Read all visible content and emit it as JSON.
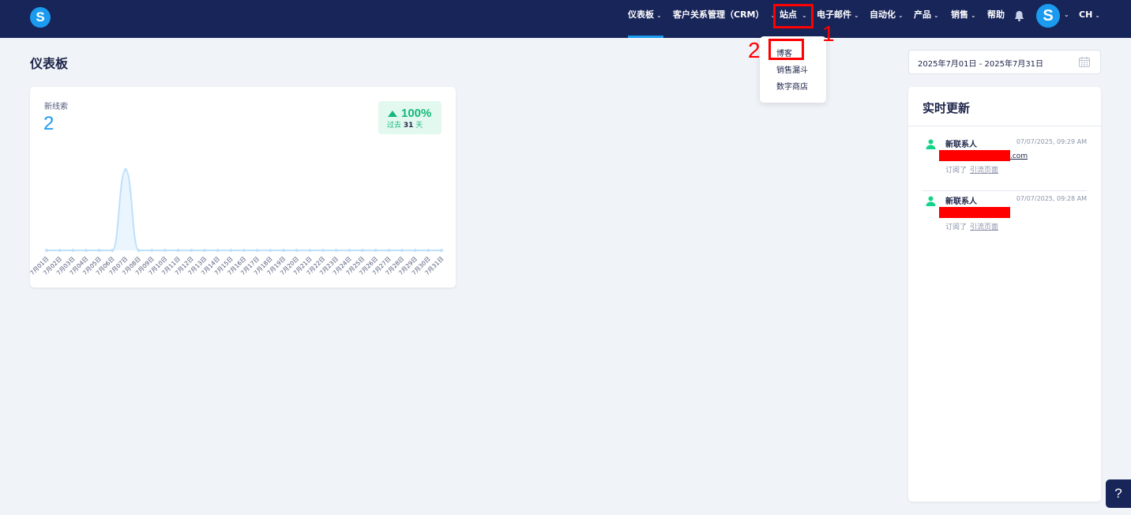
{
  "app": {
    "logo_letter": "S"
  },
  "nav": {
    "items": [
      {
        "label": "仪表板",
        "chevron": true
      },
      {
        "label": "客户关系管理（CRM）",
        "chevron": true
      },
      {
        "label": "站点",
        "chevron": true
      },
      {
        "label": "电子邮件",
        "chevron": true
      },
      {
        "label": "自动化",
        "chevron": true
      },
      {
        "label": "产品",
        "chevron": true
      },
      {
        "label": "销售",
        "chevron": true
      },
      {
        "label": "帮助",
        "chevron": false
      }
    ],
    "active": "仪表板",
    "avatar_letter": "S",
    "language": "CH",
    "bell_icon": "bell-icon"
  },
  "dropdown": {
    "items": [
      "博客",
      "销售漏斗",
      "数字商店"
    ]
  },
  "annotations": {
    "one": "1",
    "two": "2",
    "color": "#ff0000"
  },
  "page": {
    "title": "仪表板"
  },
  "date_range": {
    "value": "2025年7月01日 - 2025年7月31日",
    "icon": "calendar-icon"
  },
  "card": {
    "label": "新线索",
    "value": "2",
    "badge": {
      "percent": "100%",
      "prefix": "过去",
      "days": "31",
      "suffix": "天"
    }
  },
  "chart_data": {
    "type": "area",
    "categories": [
      "7月01日",
      "7月02日",
      "7月03日",
      "7月04日",
      "7月05日",
      "7月06日",
      "7月07日",
      "7月08日",
      "7月09日",
      "7月10日",
      "7月11日",
      "7月12日",
      "7月13日",
      "7月14日",
      "7月15日",
      "7月16日",
      "7月17日",
      "7月18日",
      "7月19日",
      "7月20日",
      "7月21日",
      "7月22日",
      "7月23日",
      "7月24日",
      "7月25日",
      "7月26日",
      "7月27日",
      "7月28日",
      "7月29日",
      "7月30日",
      "7月31日"
    ],
    "values": [
      0,
      0,
      0,
      0,
      0,
      0,
      2,
      0,
      0,
      0,
      0,
      0,
      0,
      0,
      0,
      0,
      0,
      0,
      0,
      0,
      0,
      0,
      0,
      0,
      0,
      0,
      0,
      0,
      0,
      0,
      0
    ],
    "ylim": [
      0,
      2
    ],
    "grid": false,
    "color": "#1a9bf0"
  },
  "realtime": {
    "title": "实时更新",
    "entries": [
      {
        "name": "新联系人",
        "time": "07/07/2025, 09:29 AM",
        "email_suffix": ".com",
        "action": "订阅了",
        "link": "引流页面"
      },
      {
        "name": "新联系人",
        "time": "07/07/2025, 09:28 AM",
        "email_suffix": "",
        "action": "订阅了",
        "link": "引流页面"
      }
    ]
  },
  "help": {
    "label": "?"
  },
  "colors": {
    "nav_bg": "#182559",
    "accent": "#1a9bf0",
    "success": "#13b97b",
    "page_bg": "#f0f4f8"
  }
}
